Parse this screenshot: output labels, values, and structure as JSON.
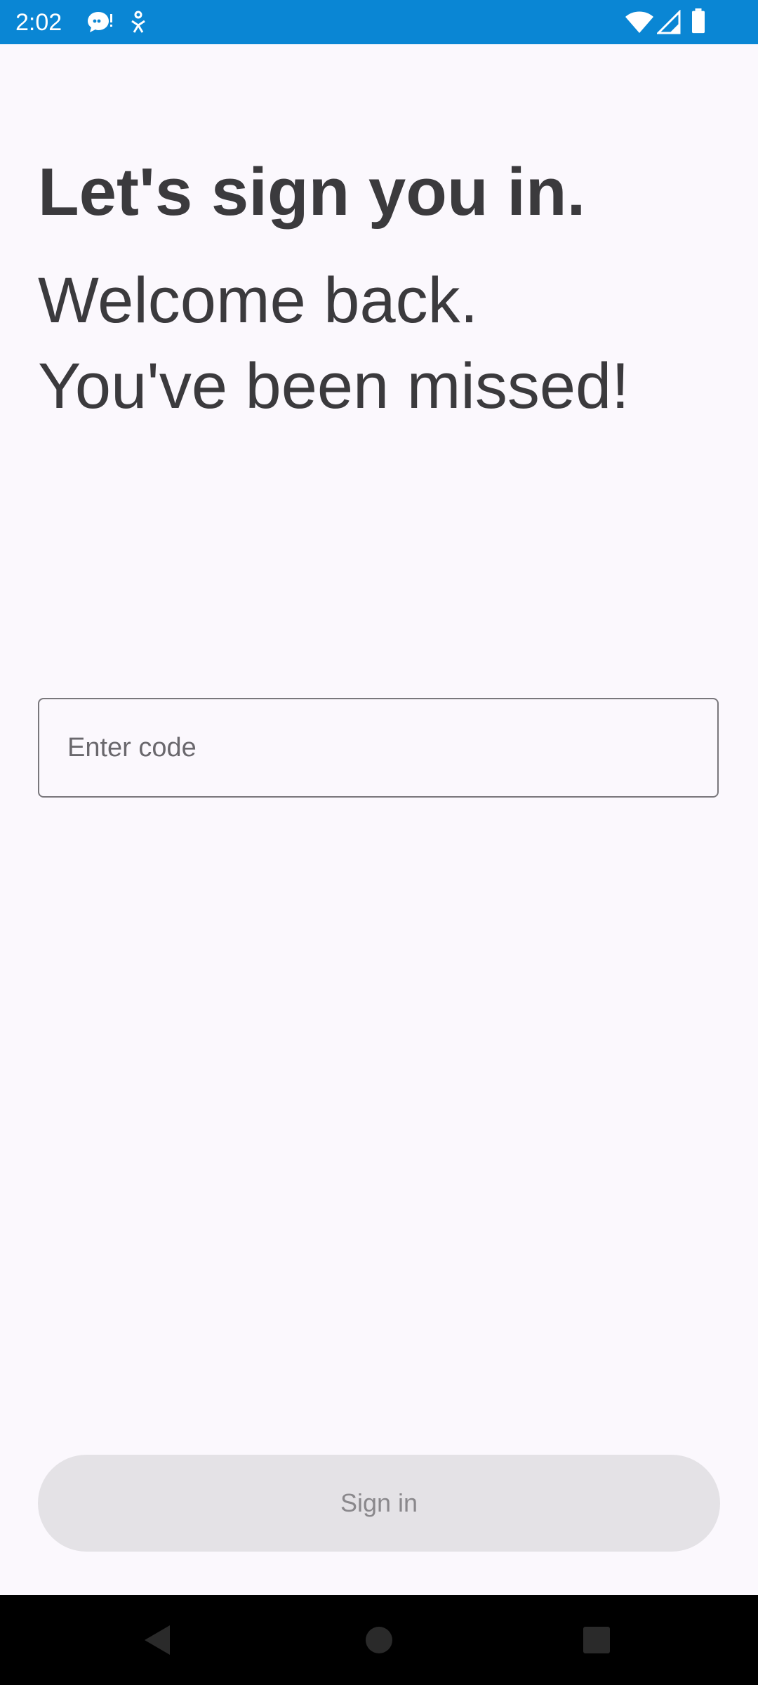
{
  "status_bar": {
    "time": "2:02",
    "background_color": "#0a86d4",
    "icons": [
      "chat-notification-icon",
      "accessibility-icon",
      "wifi-icon",
      "cellular-signal-icon",
      "battery-icon"
    ]
  },
  "header": {
    "title": "Let's sign you in.",
    "subtitle_line1": "Welcome back.",
    "subtitle_line2": "You've been missed!"
  },
  "form": {
    "code_input": {
      "placeholder": "Enter code",
      "value": ""
    },
    "sign_in_label": "Sign in",
    "sign_in_enabled": false
  },
  "nav_bar": {
    "buttons": [
      "back-icon",
      "home-icon",
      "recents-icon"
    ]
  }
}
